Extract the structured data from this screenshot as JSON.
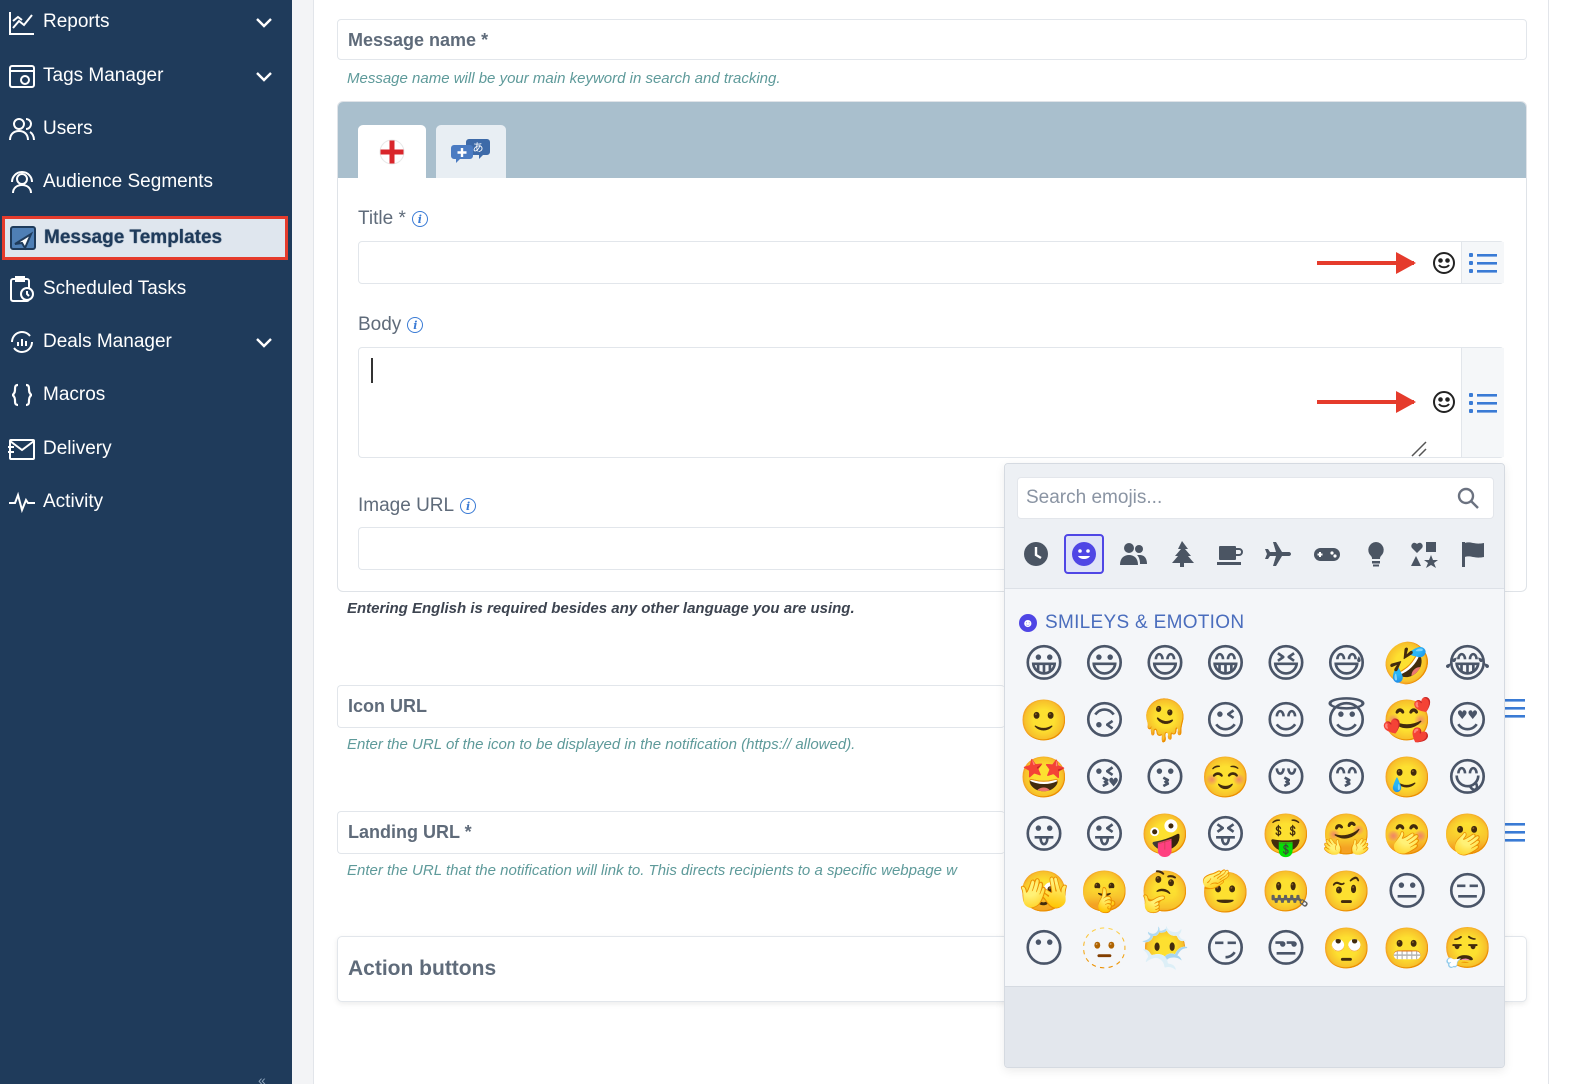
{
  "sidebar": {
    "items": [
      {
        "label": "Reports",
        "icon": "reports-icon",
        "has_chevron": true
      },
      {
        "label": "Tags Manager",
        "icon": "tags-manager-icon",
        "has_chevron": true
      },
      {
        "label": "Users",
        "icon": "users-icon",
        "has_chevron": false
      },
      {
        "label": "Audience Segments",
        "icon": "audience-segments-icon",
        "has_chevron": false
      },
      {
        "label": "Message Templates",
        "icon": "message-templates-icon",
        "has_chevron": false,
        "active": true
      },
      {
        "label": "Scheduled Tasks",
        "icon": "scheduled-tasks-icon",
        "has_chevron": false
      },
      {
        "label": "Deals Manager",
        "icon": "deals-manager-icon",
        "has_chevron": true
      },
      {
        "label": "Macros",
        "icon": "macros-icon",
        "has_chevron": false
      },
      {
        "label": "Delivery",
        "icon": "delivery-icon",
        "has_chevron": false
      },
      {
        "label": "Activity",
        "icon": "activity-icon",
        "has_chevron": false
      }
    ],
    "collapse_glyph": "«"
  },
  "form": {
    "message_name": {
      "label": "Message name *",
      "hint": "Message name will be your main keyword in search and tracking."
    },
    "language_tabs": [
      {
        "icon": "english-flag-icon"
      },
      {
        "icon": "add-language-icon"
      }
    ],
    "title": {
      "label": "Title *"
    },
    "body": {
      "label": "Body"
    },
    "image_url": {
      "label": "Image URL"
    },
    "language_note": "Entering English is required besides any other language you are using.",
    "icon_url": {
      "label": "Icon URL",
      "hint": "Enter the URL of the icon to be displayed in the notification (https:// allowed)."
    },
    "landing_url": {
      "label": "Landing URL *",
      "hint": "Enter the URL that the notification will link to. This directs recipients to a specific webpage w"
    },
    "action_buttons": {
      "label": "Action buttons"
    }
  },
  "emoji_picker": {
    "search_placeholder": "Search emojis...",
    "categories": [
      "recent-icon",
      "smileys-icon",
      "people-icon",
      "nature-icon",
      "food-icon",
      "travel-icon",
      "activities-icon",
      "objects-icon",
      "symbols-icon",
      "flags-icon"
    ],
    "active_category": "smileys-icon",
    "section_title": "SMILEYS & EMOTION",
    "emojis": [
      "😀",
      "😃",
      "😄",
      "😁",
      "😆",
      "😅",
      "🤣",
      "😂",
      "🙂",
      "🙃",
      "🫠",
      "😉",
      "😊",
      "😇",
      "🥰",
      "😍",
      "🤩",
      "😘",
      "😗",
      "☺️",
      "😚",
      "😙",
      "🥲",
      "😋",
      "😛",
      "😜",
      "🤪",
      "😝",
      "🤑",
      "🤗",
      "🤭",
      "🫢",
      "🫣",
      "🤫",
      "🤔",
      "🫡",
      "🤐",
      "🤨",
      "😐",
      "😑",
      "😶",
      "🫥",
      "😶‍🌫️",
      "😏",
      "😒",
      "🙄",
      "😬",
      "😮‍💨"
    ]
  },
  "colors": {
    "sidebar_bg": "#1f3b5b",
    "active_border": "#e53b2c",
    "annotation_arrow": "#e53b2c",
    "accent": "#4f46e5",
    "hint_text": "#5e9a9a"
  }
}
